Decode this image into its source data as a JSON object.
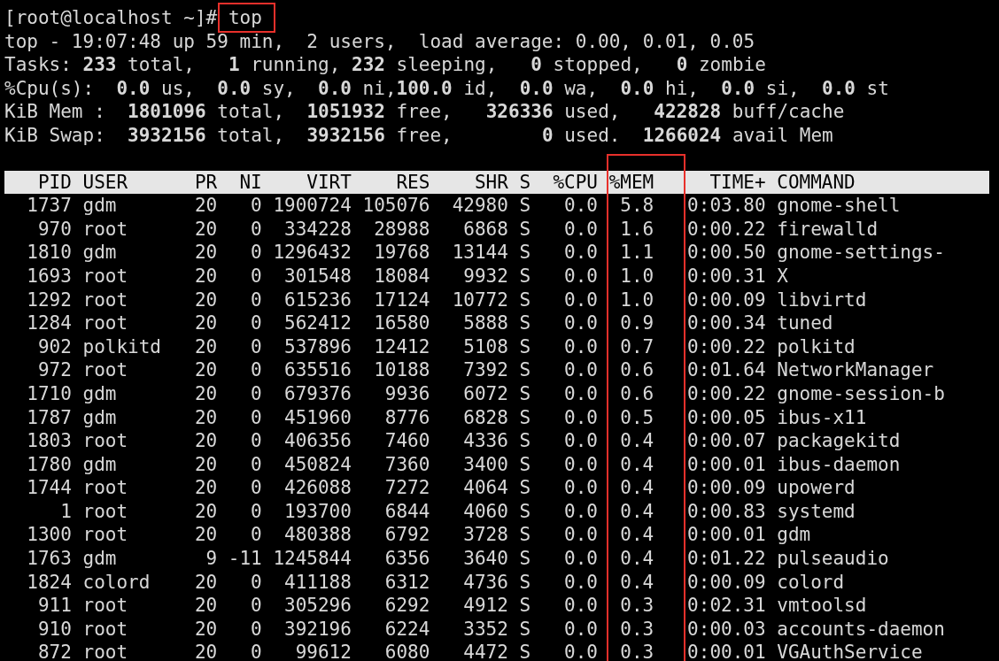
{
  "prompt": {
    "text": "[root@localhost ~]#",
    "command": "top",
    "highlighted": true
  },
  "summary": [
    "top - 19:07:48 up 59 min,  2 users,  load average: 0.00, 0.01, 0.05",
    "Tasks: **233** total,   **1** running, **232** sleeping,   **0** stopped,   **0** zombie",
    "%Cpu(s):  **0.0** us,  **0.0** sy,  **0.0** ni,**100.0** id,  **0.0** wa,  **0.0** hi,  **0.0** si,  **0.0** st",
    "KiB Mem :  **1801096** total,  **1051932** free,   **326336** used,   **422828** buff/cache",
    "KiB Swap:  **3932156** total,  **3932156** free,        **0** used.  **1266024** avail Mem"
  ],
  "table": {
    "columns": [
      {
        "label": "PID",
        "highlighted": false
      },
      {
        "label": "USER",
        "highlighted": false
      },
      {
        "label": "PR",
        "highlighted": false
      },
      {
        "label": "NI",
        "highlighted": false
      },
      {
        "label": "VIRT",
        "highlighted": false
      },
      {
        "label": "RES",
        "highlighted": false
      },
      {
        "label": "SHR",
        "highlighted": false
      },
      {
        "label": "S",
        "highlighted": false
      },
      {
        "label": "%CPU",
        "highlighted": false
      },
      {
        "label": "%MEM",
        "highlighted": true
      },
      {
        "label": "TIME+",
        "highlighted": false
      },
      {
        "label": "COMMAND",
        "highlighted": false
      }
    ],
    "rows": [
      [
        "1737",
        "gdm",
        "20",
        "0",
        "1900724",
        "105076",
        "42980",
        "S",
        "0.0",
        "5.8",
        "0:03.80",
        "gnome-shell"
      ],
      [
        "970",
        "root",
        "20",
        "0",
        "334228",
        "28988",
        "6868",
        "S",
        "0.0",
        "1.6",
        "0:00.22",
        "firewalld"
      ],
      [
        "1810",
        "gdm",
        "20",
        "0",
        "1296432",
        "19768",
        "13144",
        "S",
        "0.0",
        "1.1",
        "0:00.50",
        "gnome-settings-"
      ],
      [
        "1693",
        "root",
        "20",
        "0",
        "301548",
        "18084",
        "9932",
        "S",
        "0.0",
        "1.0",
        "0:00.31",
        "X"
      ],
      [
        "1292",
        "root",
        "20",
        "0",
        "615236",
        "17124",
        "10772",
        "S",
        "0.0",
        "1.0",
        "0:00.09",
        "libvirtd"
      ],
      [
        "1284",
        "root",
        "20",
        "0",
        "562412",
        "16580",
        "5888",
        "S",
        "0.0",
        "0.9",
        "0:00.34",
        "tuned"
      ],
      [
        "902",
        "polkitd",
        "20",
        "0",
        "537896",
        "12412",
        "5108",
        "S",
        "0.0",
        "0.7",
        "0:00.22",
        "polkitd"
      ],
      [
        "972",
        "root",
        "20",
        "0",
        "635516",
        "10188",
        "7392",
        "S",
        "0.0",
        "0.6",
        "0:01.64",
        "NetworkManager"
      ],
      [
        "1710",
        "gdm",
        "20",
        "0",
        "679376",
        "9936",
        "6072",
        "S",
        "0.0",
        "0.6",
        "0:00.22",
        "gnome-session-b"
      ],
      [
        "1787",
        "gdm",
        "20",
        "0",
        "451960",
        "8776",
        "6828",
        "S",
        "0.0",
        "0.5",
        "0:00.05",
        "ibus-x11"
      ],
      [
        "1803",
        "root",
        "20",
        "0",
        "406356",
        "7460",
        "4336",
        "S",
        "0.0",
        "0.4",
        "0:00.07",
        "packagekitd"
      ],
      [
        "1780",
        "gdm",
        "20",
        "0",
        "450824",
        "7360",
        "3400",
        "S",
        "0.0",
        "0.4",
        "0:00.01",
        "ibus-daemon"
      ],
      [
        "1744",
        "root",
        "20",
        "0",
        "426088",
        "7272",
        "4064",
        "S",
        "0.0",
        "0.4",
        "0:00.09",
        "upowerd"
      ],
      [
        "1",
        "root",
        "20",
        "0",
        "193700",
        "6844",
        "4060",
        "S",
        "0.0",
        "0.4",
        "0:00.83",
        "systemd"
      ],
      [
        "1300",
        "root",
        "20",
        "0",
        "480388",
        "6792",
        "3728",
        "S",
        "0.0",
        "0.4",
        "0:00.01",
        "gdm"
      ],
      [
        "1763",
        "gdm",
        "9",
        "-11",
        "1245844",
        "6356",
        "3640",
        "S",
        "0.0",
        "0.4",
        "0:01.22",
        "pulseaudio"
      ],
      [
        "1824",
        "colord",
        "20",
        "0",
        "411188",
        "6312",
        "4736",
        "S",
        "0.0",
        "0.4",
        "0:00.09",
        "colord"
      ],
      [
        "911",
        "root",
        "20",
        "0",
        "305296",
        "6292",
        "4912",
        "S",
        "0.0",
        "0.3",
        "0:02.31",
        "vmtoolsd"
      ],
      [
        "910",
        "root",
        "20",
        "0",
        "392196",
        "6224",
        "3352",
        "S",
        "0.0",
        "0.3",
        "0:00.03",
        "accounts-daemon"
      ],
      [
        "872",
        "root",
        "20",
        "0",
        "99612",
        "6080",
        "4472",
        "S",
        "0.0",
        "0.3",
        "0:00.01",
        "VGAuthService"
      ]
    ]
  }
}
